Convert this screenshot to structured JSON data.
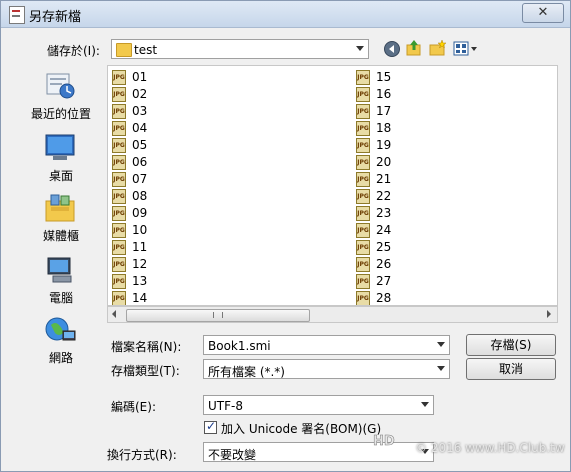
{
  "window": {
    "title": "另存新檔",
    "close_icon": "close-icon"
  },
  "save_in": {
    "label": "儲存於(I):",
    "value": "test"
  },
  "places": [
    {
      "label": "最近的位置",
      "icon": "recent-places-icon"
    },
    {
      "label": "桌面",
      "icon": "desktop-icon"
    },
    {
      "label": "媒體櫃",
      "icon": "libraries-icon"
    },
    {
      "label": "電腦",
      "icon": "computer-icon"
    },
    {
      "label": "網路",
      "icon": "network-icon"
    }
  ],
  "files_col1": [
    "01",
    "02",
    "03",
    "04",
    "05",
    "06",
    "07",
    "08",
    "09",
    "10",
    "11",
    "12",
    "13",
    "14"
  ],
  "files_col2": [
    "15",
    "16",
    "17",
    "18",
    "19",
    "20",
    "21",
    "22",
    "23",
    "24",
    "25",
    "26",
    "27",
    "28"
  ],
  "file_icon_text": "JPG",
  "filename": {
    "label": "檔案名稱(N):",
    "value": "Book1.smi"
  },
  "filetype": {
    "label": "存檔類型(T):",
    "value": "所有檔案 (*.*)"
  },
  "encoding": {
    "label": "編碼(E):",
    "value": "UTF-8"
  },
  "bom": {
    "label": "加入 Unicode 署名(BOM)(G)",
    "checked": true
  },
  "linebreak": {
    "label": "換行方式(R):",
    "value": "不要改變"
  },
  "buttons": {
    "save": "存檔(S)",
    "cancel": "取消"
  },
  "watermark": {
    "text": "© 2016 www.HD.Club.tw"
  }
}
